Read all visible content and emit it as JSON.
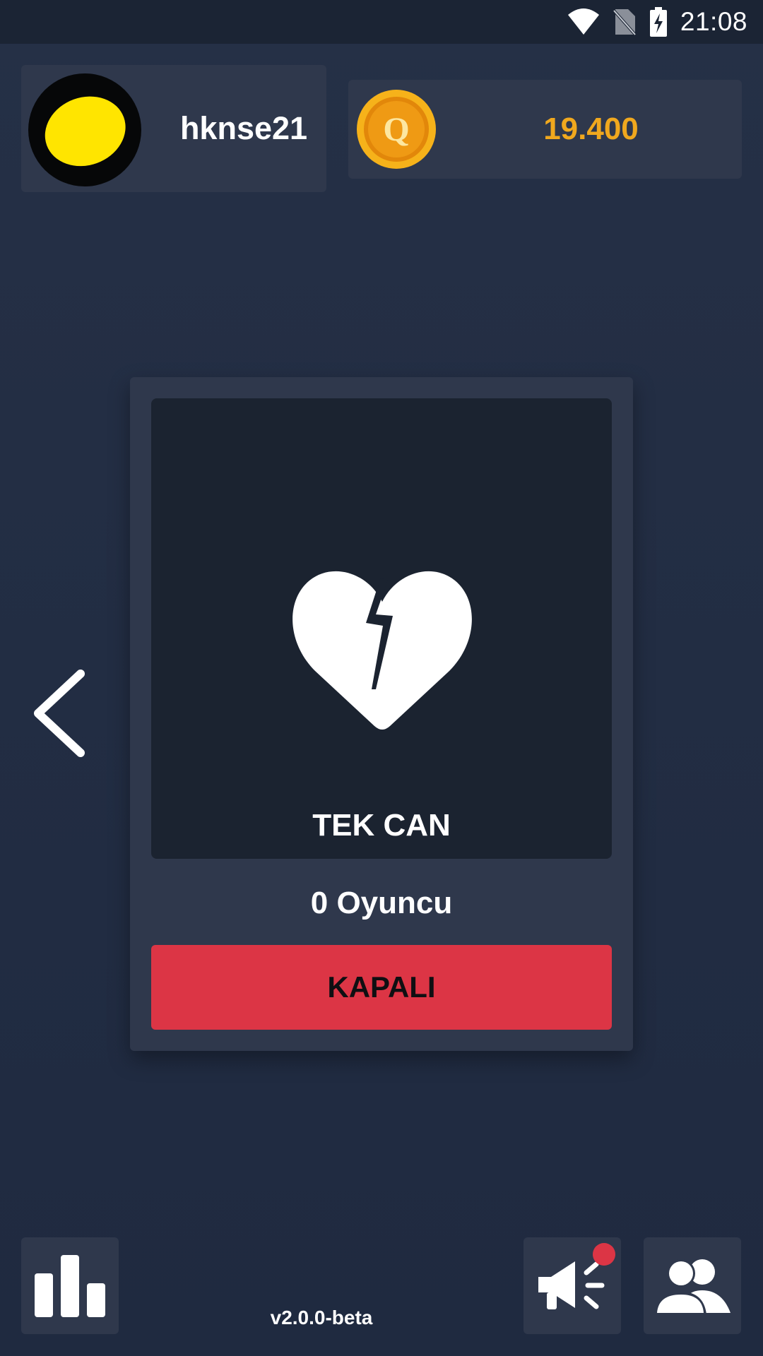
{
  "status_bar": {
    "time": "21:08",
    "icons": [
      "wifi-icon",
      "no-sim-icon",
      "battery-charging-icon"
    ]
  },
  "profile": {
    "username": "hknse21",
    "avatar": "yellow-lemon-avatar"
  },
  "wallet": {
    "coin_icon": "q-coin-icon",
    "amount": "19.400"
  },
  "game_mode": {
    "icon": "broken-heart-icon",
    "title": "TEK CAN",
    "players": "0 Oyuncu",
    "status_button": "KAPALI"
  },
  "navigation": {
    "prev_icon": "chevron-left-icon"
  },
  "bottom_bar": {
    "left_icon": "bar-chart-icon",
    "version": "v2.0.0-beta",
    "announce_icon": "megaphone-icon",
    "friends_icon": "users-icon",
    "announce_has_notification": true
  },
  "colors": {
    "background": "#212b40",
    "card": "#2f384c",
    "panel": "#1b2330",
    "accent_gold": "#f0a81e",
    "danger": "#dc3545"
  }
}
